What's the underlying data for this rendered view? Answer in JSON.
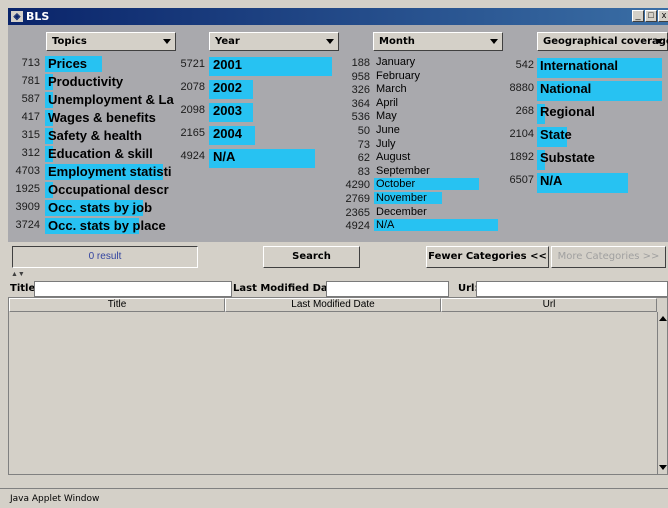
{
  "window": {
    "title": "BLS",
    "icon": "app-icon",
    "min_glyph": "_",
    "max_glyph": "□",
    "close_glyph": "x"
  },
  "filters": {
    "topics": {
      "label": "Topics",
      "items": [
        {
          "count": "713",
          "label": "Prices",
          "fraction": 0.46
        },
        {
          "count": "781",
          "label": "Productivity",
          "fraction": 0.05
        },
        {
          "count": "587",
          "label": "Unemployment & La",
          "fraction": 0.04
        },
        {
          "count": "417",
          "label": "Wages & benefits",
          "fraction": 0.03
        },
        {
          "count": "315",
          "label": "Safety & health",
          "fraction": 0.03
        },
        {
          "count": "312",
          "label": "Education & skill",
          "fraction": 0.03
        },
        {
          "count": "4703",
          "label": "Employment statisti",
          "fraction": 0.95
        },
        {
          "count": "1925",
          "label": "Occupational descr",
          "fraction": 0.06
        },
        {
          "count": "3909",
          "label": "Occ. stats by job",
          "fraction": 0.79
        },
        {
          "count": "3724",
          "label": "Occ. stats by place",
          "fraction": 0.76
        }
      ]
    },
    "year": {
      "label": "Year",
      "items": [
        {
          "count": "5721",
          "label": "2001",
          "fraction": 1.0
        },
        {
          "count": "2078",
          "label": "2002",
          "fraction": 0.36
        },
        {
          "count": "2098",
          "label": "2003",
          "fraction": 0.36
        },
        {
          "count": "2165",
          "label": "2004",
          "fraction": 0.37
        },
        {
          "count": "4924",
          "label": "N/A",
          "fraction": 0.86
        }
      ]
    },
    "month": {
      "label": "Month",
      "items": [
        {
          "count": "188",
          "label": "January",
          "fraction": 0.0
        },
        {
          "count": "958",
          "label": "February",
          "fraction": 0.0
        },
        {
          "count": "326",
          "label": "March",
          "fraction": 0.0
        },
        {
          "count": "364",
          "label": "April",
          "fraction": 0.0
        },
        {
          "count": "536",
          "label": "May",
          "fraction": 0.0
        },
        {
          "count": "50",
          "label": "June",
          "fraction": 0.0
        },
        {
          "count": "73",
          "label": "July",
          "fraction": 0.0
        },
        {
          "count": "62",
          "label": "August",
          "fraction": 0.0
        },
        {
          "count": "83",
          "label": "September",
          "fraction": 0.0
        },
        {
          "count": "4290",
          "label": "October",
          "fraction": 0.85
        },
        {
          "count": "2769",
          "label": "November",
          "fraction": 0.55
        },
        {
          "count": "2365",
          "label": "December",
          "fraction": 0.0
        },
        {
          "count": "4924",
          "label": "N/A",
          "fraction": 1.0
        }
      ]
    },
    "geo": {
      "label": "Geographical coverage",
      "items": [
        {
          "count": "542",
          "label": "International",
          "fraction": 1.0
        },
        {
          "count": "8880",
          "label": "National",
          "fraction": 1.0
        },
        {
          "count": "268",
          "label": "Regional",
          "fraction": 0.04
        },
        {
          "count": "2104",
          "label": "State",
          "fraction": 0.24
        },
        {
          "count": "1892",
          "label": "Substate",
          "fraction": 0.05
        },
        {
          "count": "6507",
          "label": "N/A",
          "fraction": 0.73
        }
      ]
    }
  },
  "buttons": {
    "result": "0 result",
    "search": "Search",
    "fewer": "Fewer Categories <<",
    "more": "More Categories >>"
  },
  "divider_glyph": "▲▼",
  "search_fields": {
    "title_label": "Title:",
    "title_value": "",
    "date_label": "Last Modified Date:",
    "date_value": "",
    "url_label": "Url:",
    "url_value": ""
  },
  "table": {
    "columns": [
      "Title",
      "Last Modified Date",
      "Url"
    ],
    "rows": []
  },
  "status": "Java Applet Window",
  "colors": {
    "accent_bar": "#27c2f2",
    "title_bar": "#0a246a",
    "panel_bg": "#a9a9ad"
  }
}
